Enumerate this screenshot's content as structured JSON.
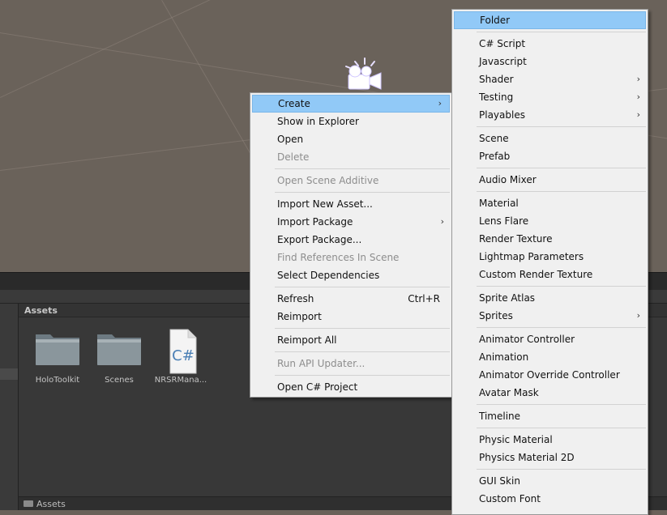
{
  "assets_panel": {
    "header": "Assets",
    "footer": "Assets",
    "items": [
      {
        "name": "HoloToolkit",
        "type": "folder"
      },
      {
        "name": "Scenes",
        "type": "folder"
      },
      {
        "name": "NRSRMana...",
        "type": "csharp"
      }
    ],
    "csharp_glyph": "C#"
  },
  "context_menu": {
    "items": [
      {
        "label": "Create",
        "arrow": "›",
        "active": true
      },
      {
        "label": "Show in Explorer"
      },
      {
        "label": "Open"
      },
      {
        "label": "Delete",
        "disabled": true
      },
      {
        "label": "Open Scene Additive",
        "disabled": true
      },
      {
        "label": "Import New Asset..."
      },
      {
        "label": "Import Package",
        "arrow": "›"
      },
      {
        "label": "Export Package..."
      },
      {
        "label": "Find References In Scene",
        "disabled": true
      },
      {
        "label": "Select Dependencies"
      },
      {
        "label": "Refresh",
        "shortcut": "Ctrl+R"
      },
      {
        "label": "Reimport"
      },
      {
        "label": "Reimport All"
      },
      {
        "label": "Run API Updater...",
        "disabled": true
      },
      {
        "label": "Open C# Project"
      }
    ]
  },
  "create_menu": {
    "items": [
      {
        "label": "Folder",
        "active": true
      },
      {
        "label": "C# Script"
      },
      {
        "label": "Javascript"
      },
      {
        "label": "Shader",
        "arrow": "›"
      },
      {
        "label": "Testing",
        "arrow": "›"
      },
      {
        "label": "Playables",
        "arrow": "›"
      },
      {
        "label": "Scene"
      },
      {
        "label": "Prefab"
      },
      {
        "label": "Audio Mixer"
      },
      {
        "label": "Material"
      },
      {
        "label": "Lens Flare"
      },
      {
        "label": "Render Texture"
      },
      {
        "label": "Lightmap Parameters"
      },
      {
        "label": "Custom Render Texture"
      },
      {
        "label": "Sprite Atlas"
      },
      {
        "label": "Sprites",
        "arrow": "›"
      },
      {
        "label": "Animator Controller"
      },
      {
        "label": "Animation"
      },
      {
        "label": "Animator Override Controller"
      },
      {
        "label": "Avatar Mask"
      },
      {
        "label": "Timeline"
      },
      {
        "label": "Physic Material"
      },
      {
        "label": "Physics Material 2D"
      },
      {
        "label": "GUI Skin"
      },
      {
        "label": "Custom Font"
      }
    ]
  },
  "colors": {
    "menu_bg": "#f0f0f0",
    "menu_highlight": "#91c9f7",
    "disabled_text": "#8d8d8d",
    "scene_bg": "#6a625a",
    "panel_bg": "#383838"
  }
}
